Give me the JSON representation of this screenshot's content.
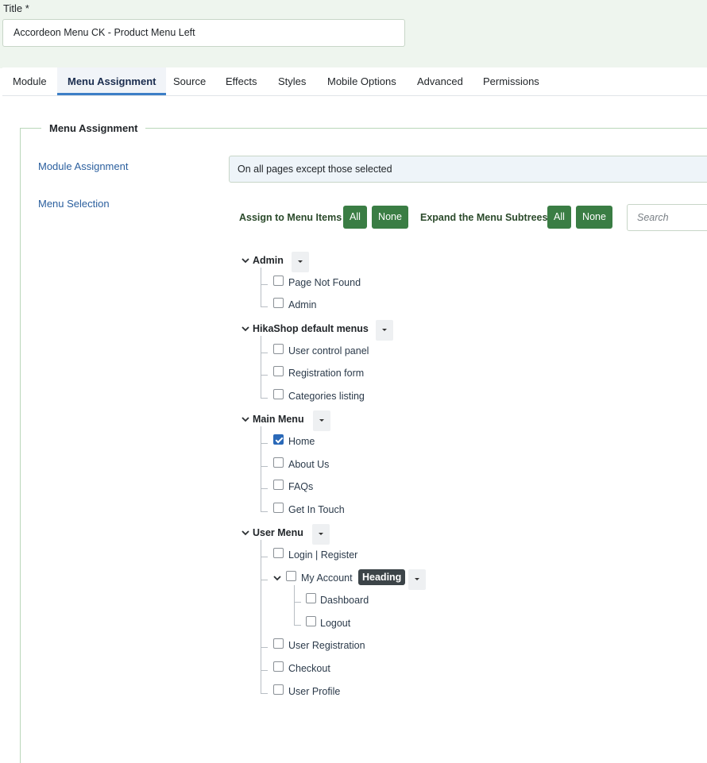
{
  "title_field": {
    "label": "Title *",
    "value": "Accordeon Menu CK - Product Menu Left"
  },
  "tabs": [
    {
      "label": "Module",
      "active": false
    },
    {
      "label": "Menu Assignment",
      "active": true
    },
    {
      "label": "Source",
      "active": false
    },
    {
      "label": "Effects",
      "active": false
    },
    {
      "label": "Styles",
      "active": false
    },
    {
      "label": "Mobile Options",
      "active": false
    },
    {
      "label": "Advanced",
      "active": false
    },
    {
      "label": "Permissions",
      "active": false
    }
  ],
  "fieldset": {
    "legend": "Menu Assignment",
    "module_assignment": {
      "label": "Module Assignment",
      "value": "On all pages except those selected"
    },
    "menu_selection": {
      "label": "Menu Selection",
      "assign_label": "Assign to Menu Items",
      "assign_all": "All",
      "assign_none": "None",
      "expand_label": "Expand the Menu Subtrees",
      "expand_all": "All",
      "expand_none": "None",
      "search_placeholder": "Search"
    }
  },
  "menus": [
    {
      "name": "Admin",
      "items": [
        {
          "label": "Page Not Found",
          "checked": false
        },
        {
          "label": "Admin",
          "checked": false
        }
      ]
    },
    {
      "name": "HikaShop default menus",
      "items": [
        {
          "label": "User control panel",
          "checked": false
        },
        {
          "label": "Registration form",
          "checked": false
        },
        {
          "label": "Categories listing",
          "checked": false
        }
      ]
    },
    {
      "name": "Main Menu",
      "items": [
        {
          "label": "Home",
          "checked": true
        },
        {
          "label": "About Us",
          "checked": false
        },
        {
          "label": "FAQs",
          "checked": false
        },
        {
          "label": "Get In Touch",
          "checked": false
        }
      ]
    },
    {
      "name": "User Menu",
      "items": [
        {
          "label": "Login | Register",
          "checked": false
        },
        {
          "label": "My Account",
          "checked": false,
          "badge": "Heading",
          "children": [
            {
              "label": "Dashboard",
              "checked": false
            },
            {
              "label": "Logout",
              "checked": false
            }
          ]
        },
        {
          "label": "User Registration",
          "checked": false
        },
        {
          "label": "Checkout",
          "checked": false
        },
        {
          "label": "User Profile",
          "checked": false
        }
      ]
    }
  ],
  "colors": {
    "accent_green": "#3a7d44",
    "checkbox_checked": "#2a69b8",
    "tab_active_underline": "#3d7fc7"
  }
}
